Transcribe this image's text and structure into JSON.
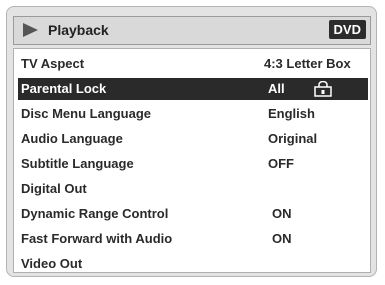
{
  "header": {
    "title": "Playback",
    "badge": "DVD",
    "icon": "play-icon"
  },
  "menu": {
    "items": [
      {
        "label": "TV Aspect",
        "value": "4:3 Letter Box",
        "selected": false
      },
      {
        "label": "Parental Lock",
        "value": "All",
        "selected": true,
        "icon": "lock-icon"
      },
      {
        "label": "Disc Menu Language",
        "value": "English",
        "selected": false
      },
      {
        "label": "Audio Language",
        "value": "Original",
        "selected": false
      },
      {
        "label": "Subtitle Language",
        "value": "OFF",
        "selected": false
      },
      {
        "label": "Digital Out",
        "value": "",
        "selected": false
      },
      {
        "label": "Dynamic Range Control",
        "value": "ON",
        "selected": false
      },
      {
        "label": "Fast Forward with Audio",
        "value": "ON",
        "selected": false
      },
      {
        "label": "Video Out",
        "value": "",
        "selected": false
      }
    ]
  },
  "colors": {
    "selection_bg": "#2a2a2a",
    "badge_bg": "#2c2c2c",
    "frame_bg": "#e3e3e3"
  }
}
